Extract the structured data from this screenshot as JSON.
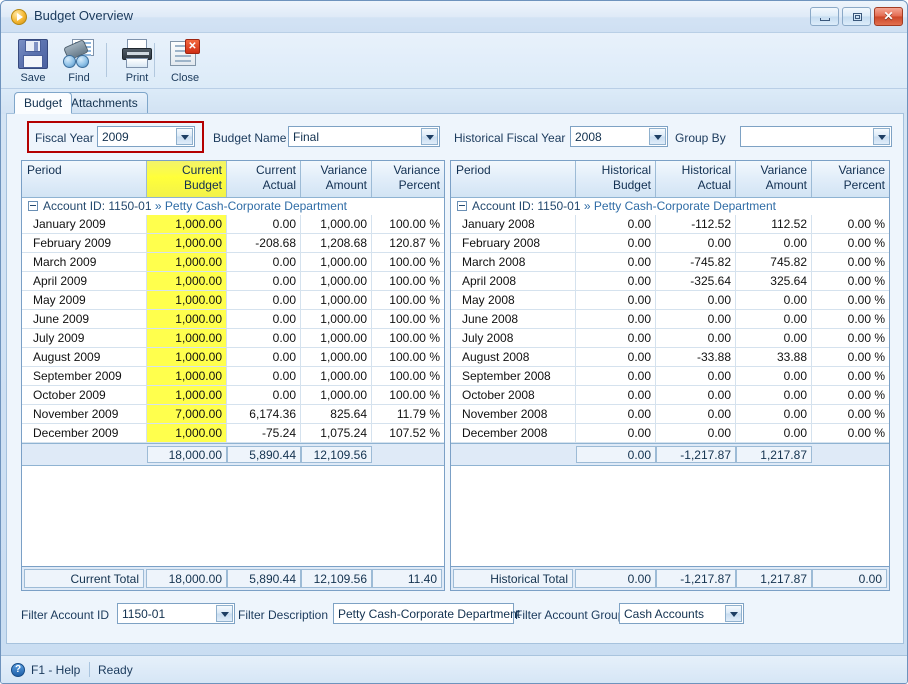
{
  "window": {
    "title": "Budget Overview",
    "icon": "play-circle-icon",
    "controls": {
      "minimize": "minimize-button",
      "maximize": "maximize-button",
      "close": "close-button",
      "close_glyph": "✕"
    }
  },
  "toolbar": {
    "items": [
      {
        "label": "Save",
        "icon": "floppy-disk-icon"
      },
      {
        "label": "Find",
        "icon": "binoculars-icon"
      },
      {
        "label": "Print",
        "icon": "printer-icon"
      },
      {
        "label": "Close",
        "icon": "window-close-icon"
      }
    ]
  },
  "tabs": [
    {
      "label": "Budget",
      "active": true
    },
    {
      "label": "Attachments",
      "active": false
    }
  ],
  "filters_top": {
    "fiscal_year": {
      "label": "Fiscal Year",
      "value": "2009",
      "highlighted": true
    },
    "budget_name": {
      "label": "Budget Name",
      "value": "Final"
    },
    "historical_fiscal_year": {
      "label": "Historical Fiscal Year",
      "value": "2008"
    },
    "group_by": {
      "label": "Group By",
      "value": ""
    }
  },
  "left_grid": {
    "columns": [
      "Period",
      "Current Budget",
      "Current Actual",
      "Variance Amount",
      "Variance Percent"
    ],
    "highlight_column": "Current Budget",
    "group_header": {
      "prefix": "Account ID: 1150-01",
      "separator": "»",
      "description": "Petty Cash-Corporate Department"
    },
    "rows": [
      {
        "period": "January 2009",
        "budget": "1,000.00",
        "actual": "0.00",
        "variance_amount": "1,000.00",
        "variance_percent": "100.00 %"
      },
      {
        "period": "February 2009",
        "budget": "1,000.00",
        "actual": "-208.68",
        "variance_amount": "1,208.68",
        "variance_percent": "120.87 %"
      },
      {
        "period": "March 2009",
        "budget": "1,000.00",
        "actual": "0.00",
        "variance_amount": "1,000.00",
        "variance_percent": "100.00 %"
      },
      {
        "period": "April 2009",
        "budget": "1,000.00",
        "actual": "0.00",
        "variance_amount": "1,000.00",
        "variance_percent": "100.00 %"
      },
      {
        "period": "May 2009",
        "budget": "1,000.00",
        "actual": "0.00",
        "variance_amount": "1,000.00",
        "variance_percent": "100.00 %"
      },
      {
        "period": "June 2009",
        "budget": "1,000.00",
        "actual": "0.00",
        "variance_amount": "1,000.00",
        "variance_percent": "100.00 %"
      },
      {
        "period": "July 2009",
        "budget": "1,000.00",
        "actual": "0.00",
        "variance_amount": "1,000.00",
        "variance_percent": "100.00 %"
      },
      {
        "period": "August 2009",
        "budget": "1,000.00",
        "actual": "0.00",
        "variance_amount": "1,000.00",
        "variance_percent": "100.00 %"
      },
      {
        "period": "September 2009",
        "budget": "1,000.00",
        "actual": "0.00",
        "variance_amount": "1,000.00",
        "variance_percent": "100.00 %"
      },
      {
        "period": "October 2009",
        "budget": "1,000.00",
        "actual": "0.00",
        "variance_amount": "1,000.00",
        "variance_percent": "100.00 %"
      },
      {
        "period": "November 2009",
        "budget": "7,000.00",
        "actual": "6,174.36",
        "variance_amount": "825.64",
        "variance_percent": "11.79 %"
      },
      {
        "period": "December 2009",
        "budget": "1,000.00",
        "actual": "-75.24",
        "variance_amount": "1,075.24",
        "variance_percent": "107.52 %"
      }
    ],
    "subtotal": {
      "budget": "18,000.00",
      "actual": "5,890.44",
      "variance_amount": "12,109.56",
      "variance_percent": ""
    },
    "total": {
      "label": "Current Total",
      "budget": "18,000.00",
      "actual": "5,890.44",
      "variance_amount": "12,109.56",
      "variance_percent": "11.40"
    }
  },
  "right_grid": {
    "columns": [
      "Period",
      "Historical Budget",
      "Historical Actual",
      "Variance Amount",
      "Variance Percent"
    ],
    "group_header": {
      "prefix": "Account ID: 1150-01",
      "separator": "»",
      "description": "Petty Cash-Corporate Department"
    },
    "rows": [
      {
        "period": "January 2008",
        "budget": "0.00",
        "actual": "-112.52",
        "variance_amount": "112.52",
        "variance_percent": "0.00 %"
      },
      {
        "period": "February 2008",
        "budget": "0.00",
        "actual": "0.00",
        "variance_amount": "0.00",
        "variance_percent": "0.00 %"
      },
      {
        "period": "March 2008",
        "budget": "0.00",
        "actual": "-745.82",
        "variance_amount": "745.82",
        "variance_percent": "0.00 %"
      },
      {
        "period": "April 2008",
        "budget": "0.00",
        "actual": "-325.64",
        "variance_amount": "325.64",
        "variance_percent": "0.00 %"
      },
      {
        "period": "May 2008",
        "budget": "0.00",
        "actual": "0.00",
        "variance_amount": "0.00",
        "variance_percent": "0.00 %"
      },
      {
        "period": "June 2008",
        "budget": "0.00",
        "actual": "0.00",
        "variance_amount": "0.00",
        "variance_percent": "0.00 %"
      },
      {
        "period": "July 2008",
        "budget": "0.00",
        "actual": "0.00",
        "variance_amount": "0.00",
        "variance_percent": "0.00 %"
      },
      {
        "period": "August 2008",
        "budget": "0.00",
        "actual": "-33.88",
        "variance_amount": "33.88",
        "variance_percent": "0.00 %"
      },
      {
        "period": "September 2008",
        "budget": "0.00",
        "actual": "0.00",
        "variance_amount": "0.00",
        "variance_percent": "0.00 %"
      },
      {
        "period": "October 2008",
        "budget": "0.00",
        "actual": "0.00",
        "variance_amount": "0.00",
        "variance_percent": "0.00 %"
      },
      {
        "period": "November 2008",
        "budget": "0.00",
        "actual": "0.00",
        "variance_amount": "0.00",
        "variance_percent": "0.00 %"
      },
      {
        "period": "December 2008",
        "budget": "0.00",
        "actual": "0.00",
        "variance_amount": "0.00",
        "variance_percent": "0.00 %"
      }
    ],
    "subtotal": {
      "budget": "0.00",
      "actual": "-1,217.87",
      "variance_amount": "1,217.87",
      "variance_percent": ""
    },
    "total": {
      "label": "Historical Total",
      "budget": "0.00",
      "actual": "-1,217.87",
      "variance_amount": "1,217.87",
      "variance_percent": "0.00"
    }
  },
  "filters_bottom": {
    "account_id": {
      "label": "Filter Account ID",
      "value": "1150-01"
    },
    "description": {
      "label": "Filter Description",
      "value": "Petty Cash-Corporate Department"
    },
    "account_group": {
      "label": "Filter Account Group",
      "value": "Cash Accounts"
    }
  },
  "statusbar": {
    "help_icon": "question-mark-icon",
    "help_text": "F1 - Help",
    "status_text": "Ready"
  },
  "colors": {
    "highlight_yellow": "#ffff4d",
    "focus_red": "#b40000",
    "accent_blue": "#2f6ca6"
  }
}
